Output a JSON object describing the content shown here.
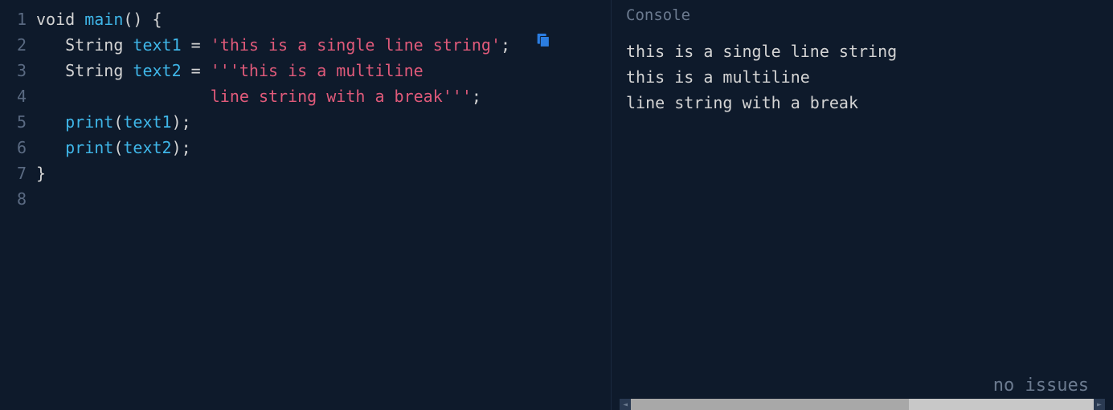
{
  "editor": {
    "lines": [
      {
        "num": "1"
      },
      {
        "num": "2"
      },
      {
        "num": "3"
      },
      {
        "num": "4"
      },
      {
        "num": "5"
      },
      {
        "num": "6"
      },
      {
        "num": "7"
      },
      {
        "num": "8"
      }
    ],
    "tokens": {
      "l1": {
        "kw_void": "void",
        "fn_main": "main",
        "paren": "()",
        "brace": " {"
      },
      "l2": {
        "indent": "   ",
        "type": "String ",
        "var": "text1",
        "eq": " = ",
        "str": "'this is a single line string'",
        "semi": ";"
      },
      "l3": {
        "indent": "   ",
        "type": "String ",
        "var": "text2",
        "eq": " = ",
        "str": "'''this is a multiline"
      },
      "l4": {
        "indent": "                  ",
        "str": "line string with a break'''",
        "semi": ";"
      },
      "l5": {
        "indent": "   ",
        "fn": "print",
        "paren_open": "(",
        "var": "text1",
        "paren_close": ")",
        "semi": ";"
      },
      "l6": {
        "indent": "   ",
        "fn": "print",
        "paren_open": "(",
        "var": "text2",
        "paren_close": ")",
        "semi": ";"
      },
      "l7": {
        "brace": "}"
      }
    }
  },
  "console": {
    "title": "Console",
    "output_line1": "this is a single line string",
    "output_line2": "this is a multiline",
    "output_blank": "",
    "output_line3": "line string with a break",
    "status": "no issues"
  }
}
